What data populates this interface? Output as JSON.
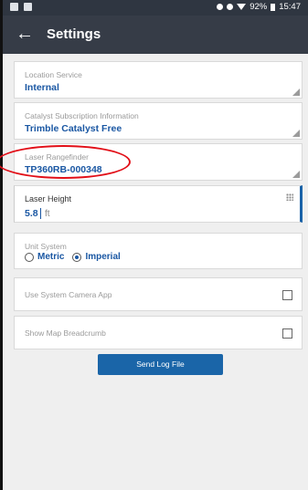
{
  "status": {
    "battery_text": "92%",
    "time": "15:47",
    "left_icons": [
      "app-icon",
      "image-icon"
    ],
    "right_icons": [
      "location-icon",
      "signal-icon",
      "wifi-icon",
      "battery-icon"
    ]
  },
  "toolbar": {
    "title": "Settings",
    "back_icon": "←"
  },
  "settings": {
    "location_service": {
      "label": "Location Service",
      "value": "Internal"
    },
    "catalyst": {
      "label": "Catalyst Subscription Information",
      "value": "Trimble Catalyst Free"
    },
    "laser_rangefinder": {
      "label": "Laser Rangefinder",
      "value": "TP360RB-000348"
    },
    "laser_height": {
      "label": "Laser Height",
      "value": "5.8",
      "unit": "ft"
    },
    "unit_system": {
      "label": "Unit System",
      "options": [
        "Metric",
        "Imperial"
      ],
      "selected": "Imperial"
    },
    "system_camera": {
      "label": "Use System Camera App",
      "checked": false
    },
    "map_breadcrumb": {
      "label": "Show Map Breadcrumb",
      "checked": false
    }
  },
  "actions": {
    "send_log": "Send Log File"
  },
  "colors": {
    "accent": "#1a57a3",
    "toolbar": "#363c47",
    "annotation": "#e20f18"
  }
}
